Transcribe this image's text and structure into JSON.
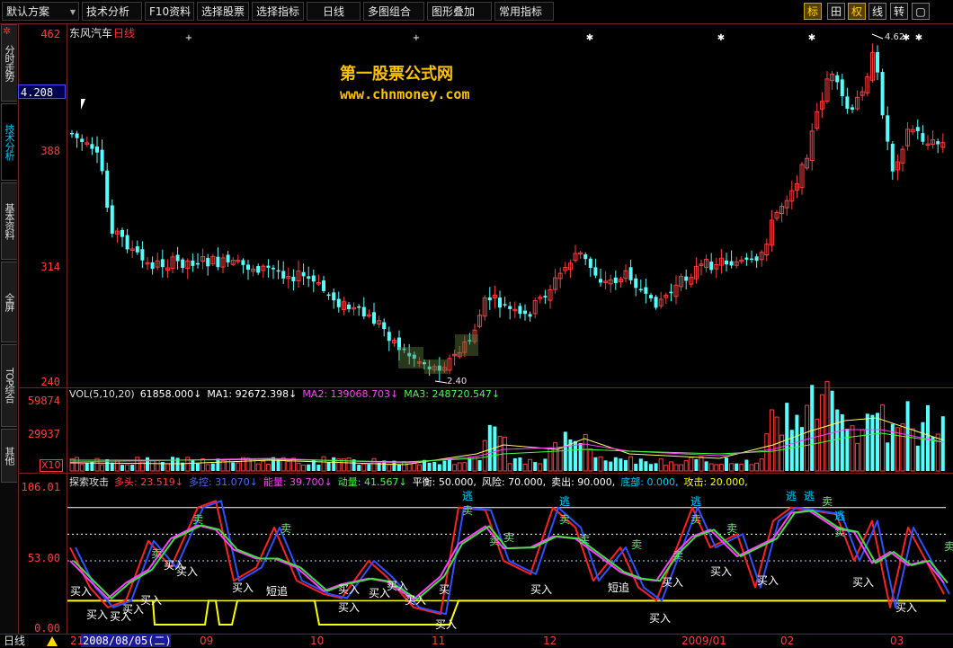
{
  "toolbar": {
    "menus": [
      "默认方案",
      "技术分析",
      "F10资料",
      "选择股票",
      "选择指标",
      "日线",
      "多图组合",
      "图形叠加",
      "常用指标"
    ],
    "right_buttons": [
      "标",
      "田",
      "权",
      "线",
      "转",
      "▢"
    ]
  },
  "sidebar": {
    "tabs": [
      "分时走势",
      "技术分析",
      "基本资料",
      "全屏",
      "TOP综合",
      "其他"
    ]
  },
  "price_panel": {
    "stock_name": "东风汽车",
    "period": "日线",
    "y_ticks": [
      "462",
      "388",
      "314",
      "240"
    ],
    "current_value": "4.208",
    "high_label": "4.62",
    "low_label": "2.40",
    "watermark_line1": "第一股票公式网",
    "watermark_line2": "www.chnmoney.com"
  },
  "volume_panel": {
    "header": [
      {
        "text": "VOL(5,10,20)",
        "color": "#e0e0e0"
      },
      {
        "text": "61858.000↓",
        "color": "#ffffff"
      },
      {
        "text": "MA1: 92672.398↓",
        "color": "#ffffff"
      },
      {
        "text": "MA2: 139068.703↓",
        "color": "#ff40ff"
      },
      {
        "text": "MA3: 248720.547↓",
        "color": "#40ff40"
      }
    ],
    "y_ticks": [
      "59874",
      "29937"
    ],
    "multiplier": "X10"
  },
  "indicator_panel": {
    "header": [
      {
        "text": "探索攻击",
        "color": "#e0e0e0"
      },
      {
        "text": "多头: 23.519↓",
        "color": "#ff4040"
      },
      {
        "text": "多控: 31.070↓",
        "color": "#4a6cff"
      },
      {
        "text": "能量: 39.700↓",
        "color": "#ff40ff"
      },
      {
        "text": "动量: 41.567↓",
        "color": "#40ff40"
      },
      {
        "text": "平衡: 50.000,",
        "color": "#ffffff"
      },
      {
        "text": "风险: 70.000,",
        "color": "#ffffff"
      },
      {
        "text": "卖出: 90.000,",
        "color": "#ffffff"
      },
      {
        "text": "底部: 0.000,",
        "color": "#00c8ff"
      },
      {
        "text": "攻击: 20.000,",
        "color": "#ffff00"
      }
    ],
    "y_ticks": [
      "106.01",
      "53.00",
      "0.00"
    ],
    "signals_buy": [
      "买入",
      "买入",
      "买入",
      "买入",
      "买入",
      "买入",
      "买入",
      "买入",
      "短追",
      "买入",
      "买入",
      "买入",
      "买入",
      "买入",
      "买",
      "买入",
      "买入",
      "短追",
      "买入",
      "买入",
      "买入",
      "买入",
      "买入"
    ],
    "signals_sell": [
      "卖",
      "卖",
      "卖",
      "卖",
      "卖",
      "卖",
      "卖",
      "卖",
      "卖",
      "卖",
      "卖",
      "卖",
      "卖",
      "卖"
    ],
    "signals_escape": [
      "逃",
      "逃",
      "逃",
      "逃",
      "逃"
    ]
  },
  "bottom_bar": {
    "label": "日线",
    "date": "2008/08/05(二)",
    "x_ticks": [
      "21",
      "09",
      "10",
      "11",
      "12",
      "2009/01",
      "02",
      "03"
    ]
  },
  "colors": {
    "up": "#ff3c3c",
    "down": "#54ffff",
    "axis": "#7a1f1f",
    "accent_yellow": "#ffff00"
  }
}
